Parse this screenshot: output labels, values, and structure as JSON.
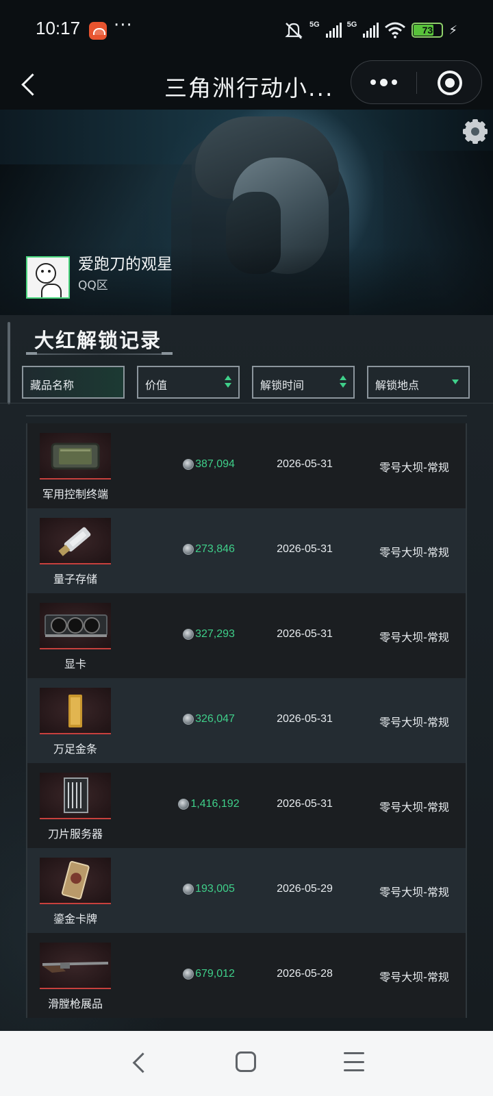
{
  "status_bar": {
    "time": "10:17",
    "dots": "···",
    "signal_1_label": "5G",
    "signal_2_label": "5G",
    "battery": "73",
    "battery_level": 0.73,
    "icons": [
      "app-notification-icon",
      "mute-icon",
      "signal-icon",
      "wifi-icon",
      "battery-icon",
      "charging-icon"
    ]
  },
  "title_bar": {
    "title": "三角洲行动小...",
    "icons": [
      "back-icon",
      "more-icon",
      "close-miniapp-icon"
    ]
  },
  "profile": {
    "username": "爱跑刀的观星",
    "server": "QQ区",
    "icons": [
      "settings-gear-icon"
    ]
  },
  "section": {
    "title": "大红解锁记录"
  },
  "filters": [
    {
      "label": "藏品名称",
      "icon": ""
    },
    {
      "label": "价值",
      "icon": "sort-icon"
    },
    {
      "label": "解锁时间",
      "icon": "sort-icon"
    },
    {
      "label": "解锁地点",
      "icon": "dropdown-icon"
    }
  ],
  "rows": [
    {
      "name": "军用控制终端",
      "value": "387,094",
      "date": "2026-05-31",
      "location": "零号大坝-常规",
      "thumb": "terminal"
    },
    {
      "name": "量子存储",
      "value": "273,846",
      "date": "2026-05-31",
      "location": "零号大坝-常规",
      "thumb": "usb"
    },
    {
      "name": "显卡",
      "value": "327,293",
      "date": "2026-05-31",
      "location": "零号大坝-常规",
      "thumb": "gpu"
    },
    {
      "name": "万足金条",
      "value": "326,047",
      "date": "2026-05-31",
      "location": "零号大坝-常规",
      "thumb": "gold"
    },
    {
      "name": "刀片服务器",
      "value": "1,416,192",
      "date": "2026-05-31",
      "location": "零号大坝-常规",
      "thumb": "server"
    },
    {
      "name": "鎏金卡牌",
      "value": "193,005",
      "date": "2026-05-29",
      "location": "零号大坝-常规",
      "thumb": "card"
    },
    {
      "name": "滑膛枪展品",
      "value": "679,012",
      "date": "2026-05-28",
      "location": "零号大坝-常规",
      "thumb": "musket"
    }
  ],
  "colors": {
    "accent_green": "#3fd08a",
    "thumb_red_line": "#c8403d",
    "row_dark": "#1b1e21",
    "row_light": "#242c32"
  },
  "system_nav": {
    "icons": [
      "nav-back-icon",
      "nav-home-icon",
      "nav-menu-icon"
    ]
  }
}
